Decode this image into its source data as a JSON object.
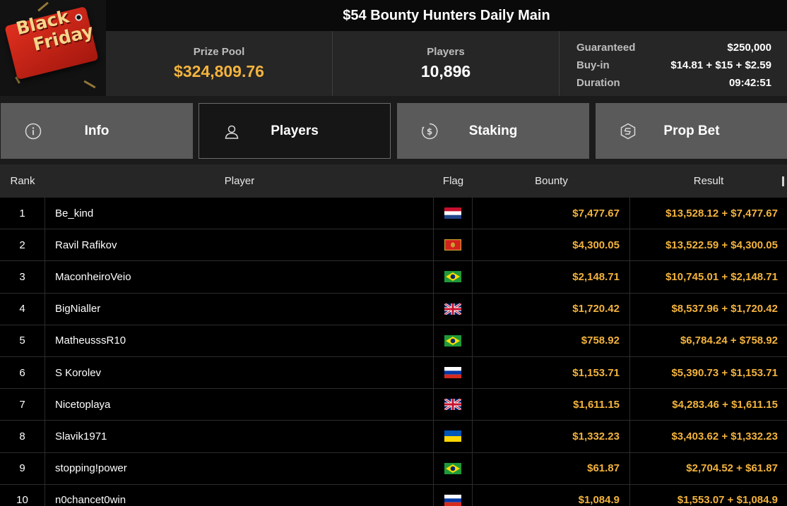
{
  "logo": {
    "line1": "Black",
    "line2": "Friday"
  },
  "tournament": {
    "title": "$54 Bounty Hunters Daily Main",
    "prize_pool_label": "Prize Pool",
    "prize_pool_value": "$324,809.76",
    "players_label": "Players",
    "players_value": "10,896",
    "details": [
      {
        "label": "Guaranteed",
        "value": "$250,000"
      },
      {
        "label": "Buy-in",
        "value": "$14.81 + $15 + $2.59"
      },
      {
        "label": "Duration",
        "value": "09:42:51"
      }
    ]
  },
  "tabs": [
    {
      "label": "Info",
      "icon": "info-icon",
      "active": false
    },
    {
      "label": "Players",
      "icon": "user-icon",
      "active": true
    },
    {
      "label": "Staking",
      "icon": "dollar-coin-icon",
      "active": false
    },
    {
      "label": "Prop Bet",
      "icon": "prop-bet-icon",
      "active": false
    }
  ],
  "table": {
    "columns": [
      "Rank",
      "Player",
      "Flag",
      "Bounty",
      "Result"
    ],
    "rows": [
      {
        "rank": "1",
        "player": "Be_kind",
        "flag": "netherlands-flag-icon",
        "bounty": "$7,477.67",
        "result": "$13,528.12 + $7,477.67"
      },
      {
        "rank": "2",
        "player": "Ravil Rafikov",
        "flag": "montenegro-flag-icon",
        "bounty": "$4,300.05",
        "result": "$13,522.59 + $4,300.05"
      },
      {
        "rank": "3",
        "player": "MaconheiroVeio",
        "flag": "brazil-flag-icon",
        "bounty": "$2,148.71",
        "result": "$10,745.01 + $2,148.71"
      },
      {
        "rank": "4",
        "player": "BigNialler",
        "flag": "uk-flag-icon",
        "bounty": "$1,720.42",
        "result": "$8,537.96 + $1,720.42"
      },
      {
        "rank": "5",
        "player": "MatheusssR10",
        "flag": "brazil-flag-icon",
        "bounty": "$758.92",
        "result": "$6,784.24 + $758.92"
      },
      {
        "rank": "6",
        "player": "S Korolev",
        "flag": "russia-flag-icon",
        "bounty": "$1,153.71",
        "result": "$5,390.73 + $1,153.71"
      },
      {
        "rank": "7",
        "player": "Nicetoplaya",
        "flag": "uk-flag-icon",
        "bounty": "$1,611.15",
        "result": "$4,283.46 + $1,611.15"
      },
      {
        "rank": "8",
        "player": "Slavik1971",
        "flag": "ukraine-flag-icon",
        "bounty": "$1,332.23",
        "result": "$3,403.62 + $1,332.23"
      },
      {
        "rank": "9",
        "player": "stopping!power",
        "flag": "brazil-flag-icon",
        "bounty": "$61.87",
        "result": "$2,704.52 + $61.87"
      },
      {
        "rank": "10",
        "player": "n0chancet0win",
        "flag": "russia-flag-icon",
        "bounty": "$1,084.9",
        "result": "$1,553.07 + $1,084.9"
      }
    ]
  },
  "colors": {
    "accent_gold": "#f3b33d",
    "tab_inactive": "#5a5a5a",
    "tab_active": "#161616",
    "header_bg": "#262626",
    "row_bg": "#000000"
  }
}
